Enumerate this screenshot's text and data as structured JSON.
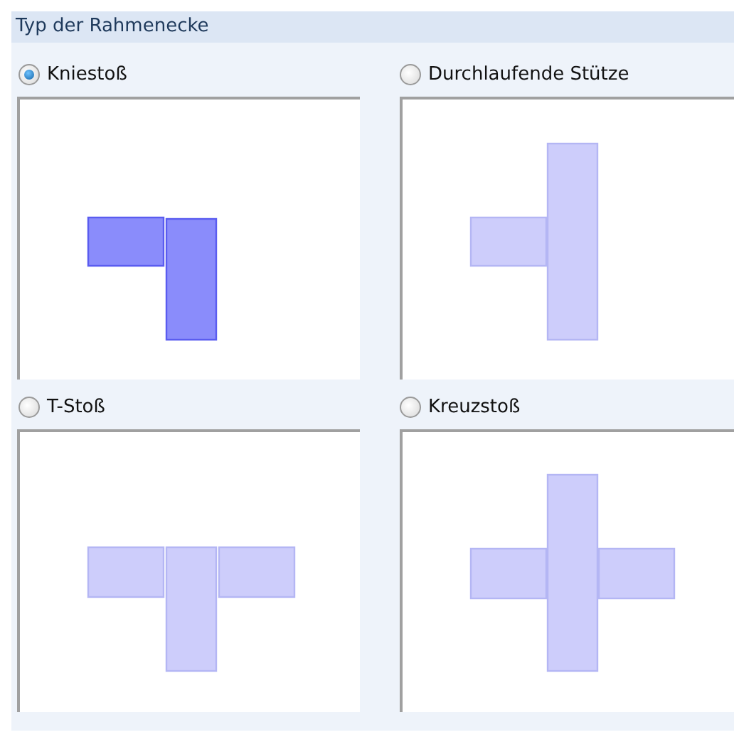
{
  "group": {
    "title": "Typ der Rahmenecke"
  },
  "options": [
    {
      "label": "Kniestoß",
      "selected": true,
      "kind": "knee"
    },
    {
      "label": "Durchlaufende Stütze",
      "selected": false,
      "kind": "continuous"
    },
    {
      "label": "T-Stoß",
      "selected": false,
      "kind": "tee"
    },
    {
      "label": "Kreuzstoß",
      "selected": false,
      "kind": "cross"
    }
  ]
}
